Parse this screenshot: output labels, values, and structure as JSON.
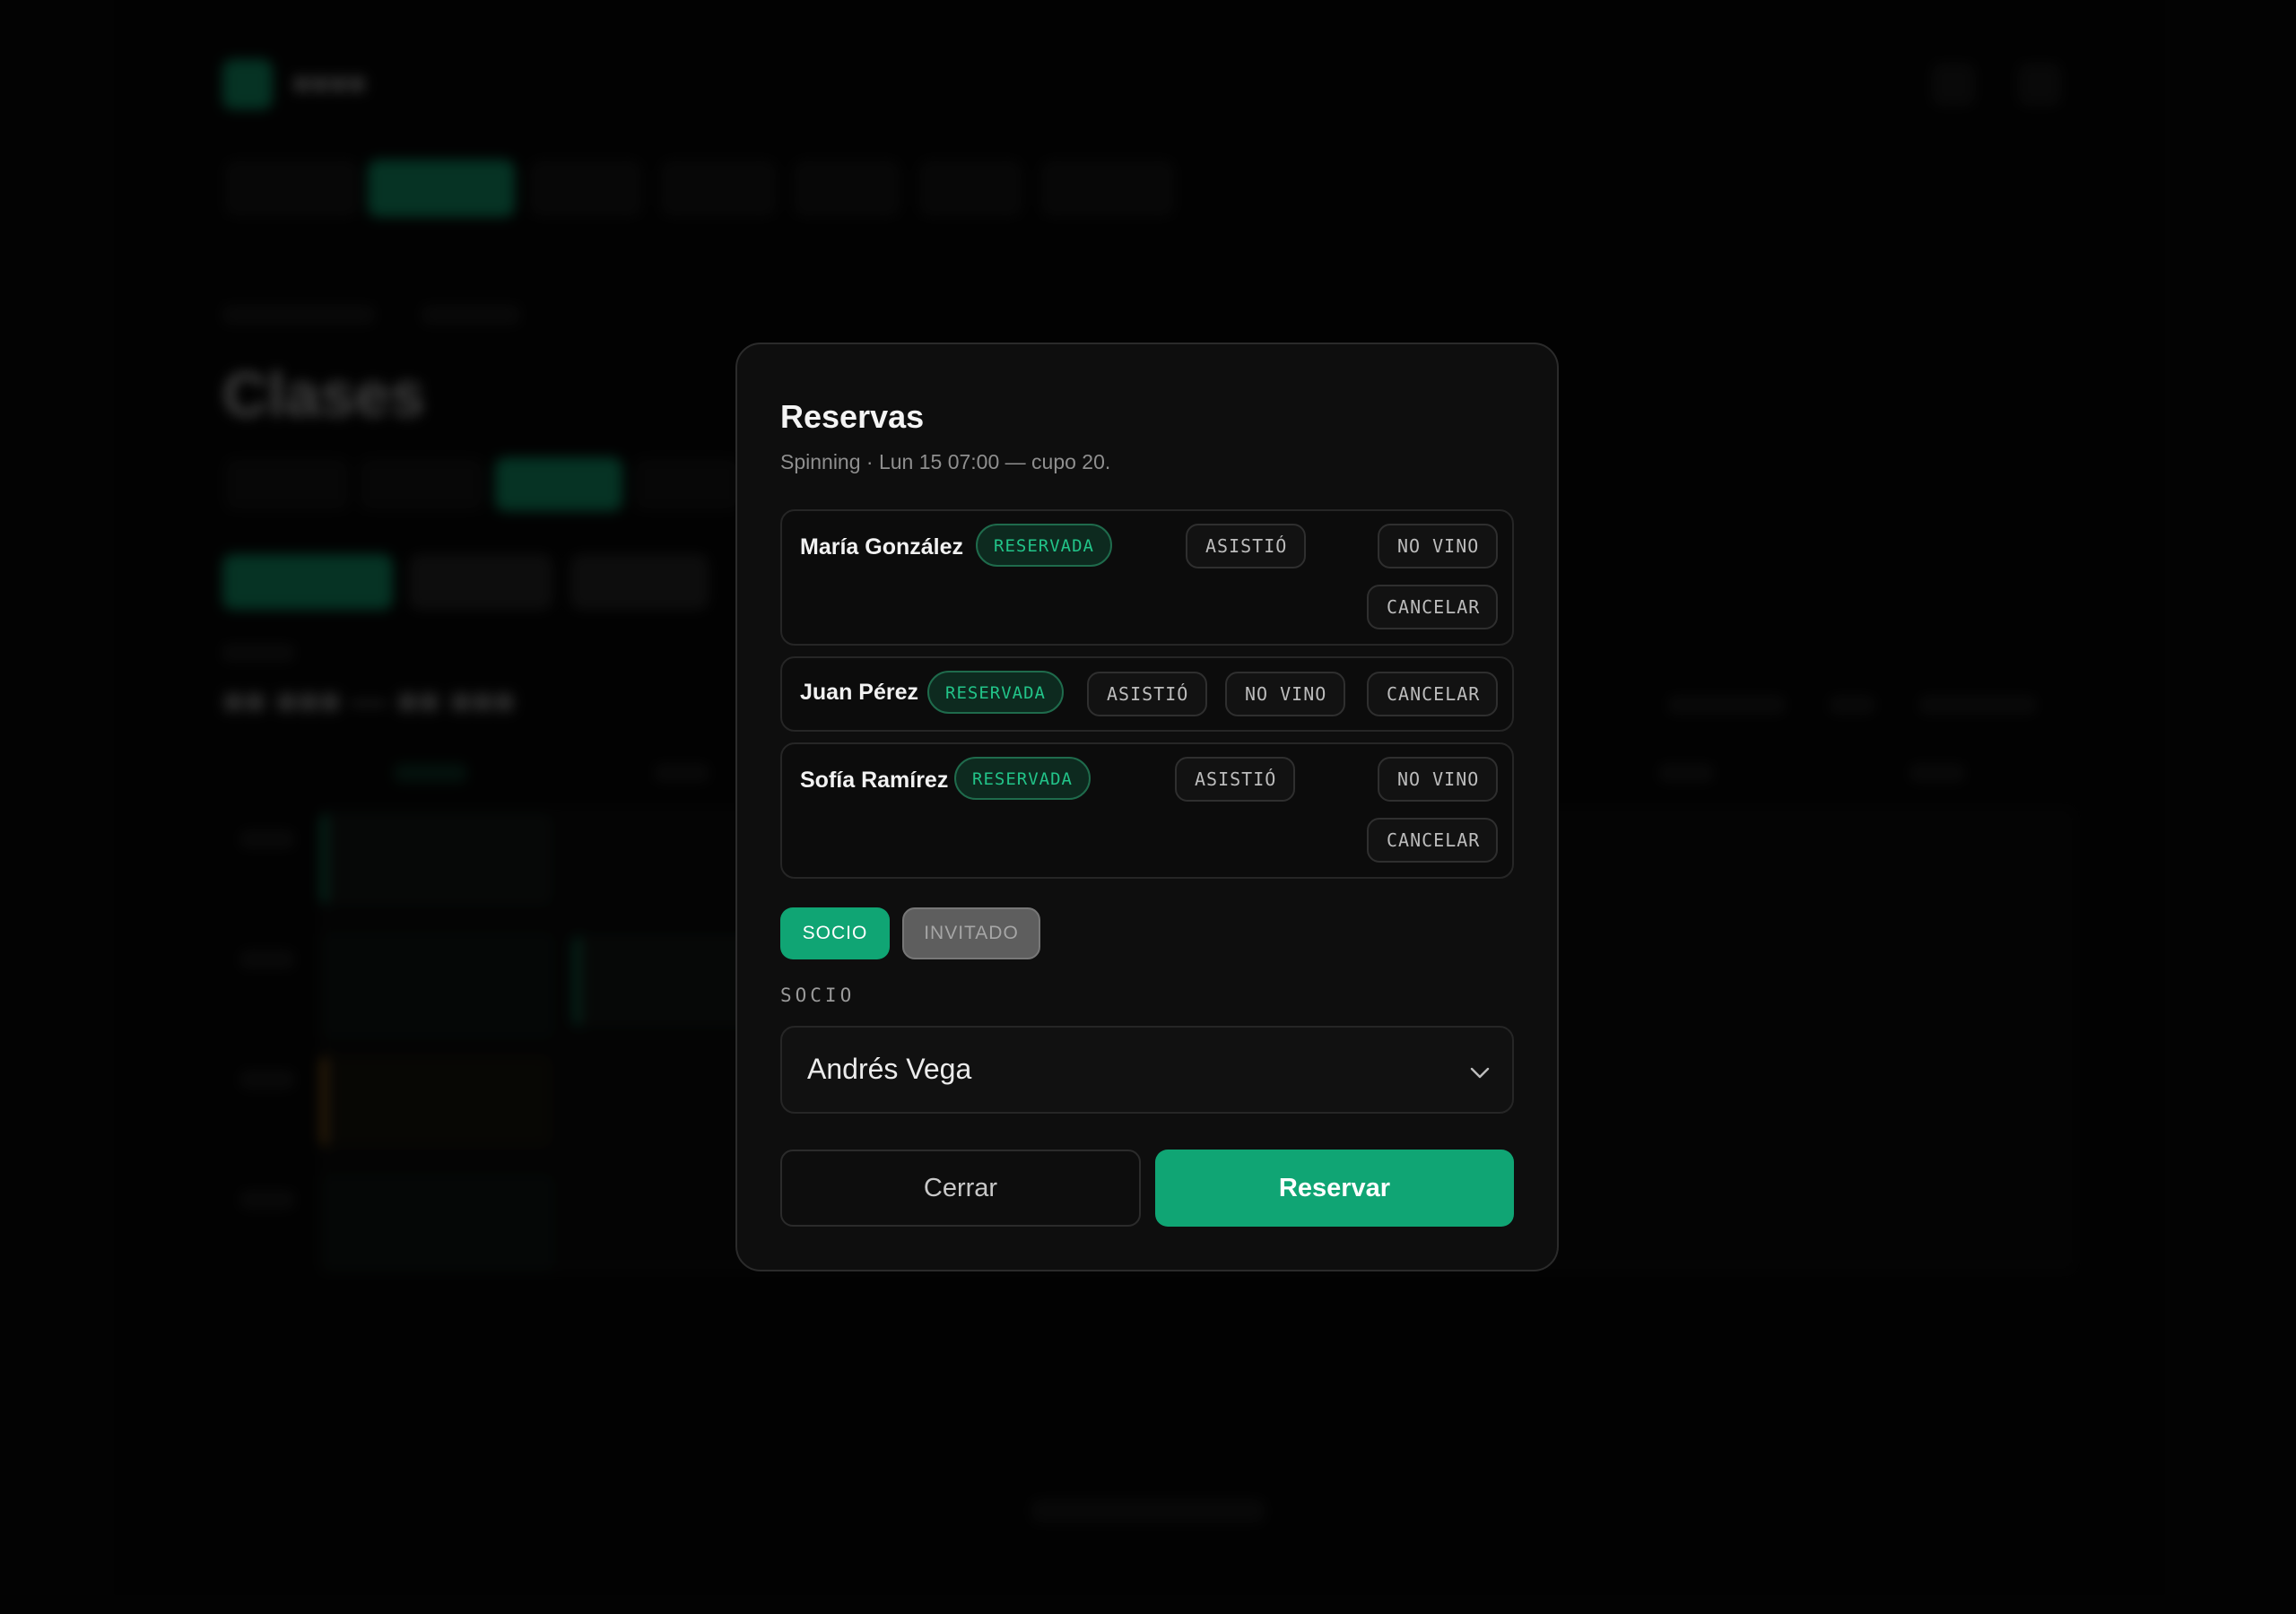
{
  "background": {
    "page_title": "Clases"
  },
  "modal": {
    "title": "Reservas",
    "subtitle": "Spinning · Lun 15 07:00 — cupo 20.",
    "reservations": [
      {
        "name": "María González",
        "status": "RESERVADA",
        "actions": [
          "ASISTIÓ",
          "NO VINO",
          "CANCELAR"
        ]
      },
      {
        "name": "Juan Pérez",
        "status": "RESERVADA",
        "actions": [
          "ASISTIÓ",
          "NO VINO",
          "CANCELAR"
        ]
      },
      {
        "name": "Sofía Ramírez",
        "status": "RESERVADA",
        "actions": [
          "ASISTIÓ",
          "NO VINO",
          "CANCELAR"
        ]
      }
    ],
    "type_toggle": {
      "options": [
        "SOCIO",
        "INVITADO"
      ],
      "selected": "SOCIO"
    },
    "field_label": "SOCIO",
    "member_select": {
      "value": "Andrés Vega"
    },
    "close_label": "Cerrar",
    "submit_label": "Reservar"
  },
  "colors": {
    "accent": "#10a574",
    "badge_text": "#22c489",
    "modal_bg": "#0e0e0e"
  },
  "icons": {
    "select_arrow": "chevron-down-icon"
  }
}
